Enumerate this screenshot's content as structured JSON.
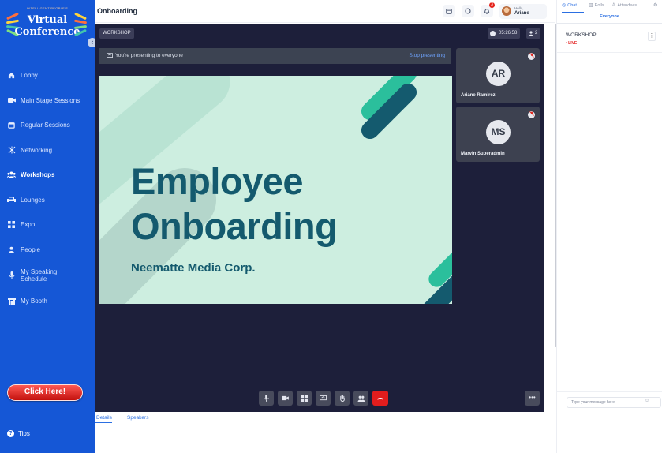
{
  "sidebar": {
    "logo_small": "INTELLIGENT PEOPLE'S",
    "logo_title_line1": "Virtual",
    "logo_title_line2": "Conference",
    "collapse_icon": "chevron-left-icon",
    "items": [
      {
        "label": "Lobby",
        "icon": "home-icon"
      },
      {
        "label": "Main Stage Sessions",
        "icon": "video-icon"
      },
      {
        "label": "Regular Sessions",
        "icon": "calendar-icon"
      },
      {
        "label": "Networking",
        "icon": "network-icon"
      },
      {
        "label": "Workshops",
        "icon": "group-icon",
        "active": true
      },
      {
        "label": "Lounges",
        "icon": "sofa-icon"
      },
      {
        "label": "Expo",
        "icon": "grid-icon"
      },
      {
        "label": "People",
        "icon": "person-icon"
      },
      {
        "label": "My Speaking Schedule",
        "icon": "microphone-icon"
      },
      {
        "label": "My Booth",
        "icon": "booth-icon"
      }
    ],
    "cta_label": "Click Here!",
    "tips_label": "Tips"
  },
  "topbar": {
    "title": "Onboarding",
    "notification_count": "3",
    "user_greeting": "Hello,",
    "user_name": "Ariane"
  },
  "stage": {
    "session_label": "WORKSHOP",
    "timer": "05:26:58",
    "participant_count": "2",
    "presenting_text": "You're presenting to everyone",
    "stop_presenting_label": "Stop presenting",
    "slide": {
      "heading_line1": "Employee",
      "heading_line2": "Onboarding",
      "subtitle": "Neematte Media Corp."
    },
    "participants": [
      {
        "initials": "AR",
        "name": "Ariane Ramirez",
        "muted": true
      },
      {
        "initials": "MS",
        "name": "Marvin Superadmin",
        "muted": true
      }
    ],
    "controls": [
      "microphone-icon",
      "camera-icon",
      "layout-icon",
      "screen-share-icon",
      "raise-hand-icon",
      "participants-icon",
      "end-call-icon"
    ],
    "more_label": "•••"
  },
  "bottom_tabs": {
    "details": "Details",
    "speakers": "Speakers"
  },
  "right_panel": {
    "tabs": [
      {
        "label": "Chat",
        "icon": "chat-icon",
        "active": true
      },
      {
        "label": "Polls",
        "icon": "poll-icon"
      },
      {
        "label": "Attendees",
        "icon": "attendees-icon"
      }
    ],
    "sub_tab": "Everyone",
    "channel_name": "WORKSHOP",
    "live_label": "• LIVE",
    "message_placeholder": "Type your message here"
  },
  "colors": {
    "sidebar_bg": "#1557d6",
    "stage_bg": "#1d1f3a",
    "slide_bg": "#cdeee0",
    "slide_text": "#145a6e",
    "accent": "#2b6fe2",
    "live": "#e21d1d"
  }
}
